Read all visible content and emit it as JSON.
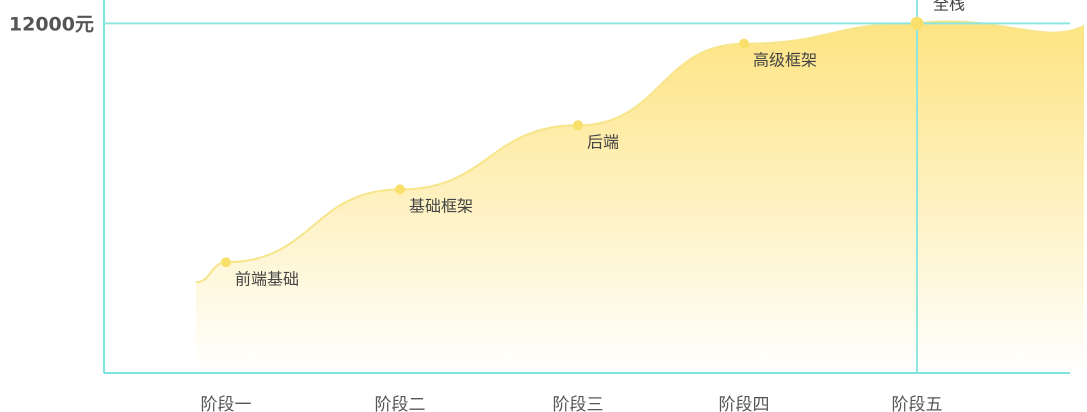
{
  "chart_data": {
    "type": "area",
    "categories": [
      "阶段一",
      "阶段二",
      "阶段三",
      "阶段四",
      "阶段五"
    ],
    "points": [
      {
        "x": "阶段一",
        "label": "前端基础",
        "value": 3800
      },
      {
        "x": "阶段二",
        "label": "基础框架",
        "value": 6300
      },
      {
        "x": "阶段三",
        "label": "后端",
        "value": 8500
      },
      {
        "x": "阶段四",
        "label": "高级框架",
        "value": 11300
      },
      {
        "x": "阶段五",
        "label": "全栈",
        "value": 12000,
        "highlight": true
      }
    ],
    "y_marker": {
      "value": 12000,
      "label": "12000元"
    },
    "ylim": [
      0,
      12800
    ],
    "grid": false,
    "colors": {
      "axis": "#7fe3dd",
      "marker_line": "#8fe6e0",
      "area": "#fde98a",
      "line": "#f7e58a",
      "point": "#f8e06a"
    }
  }
}
